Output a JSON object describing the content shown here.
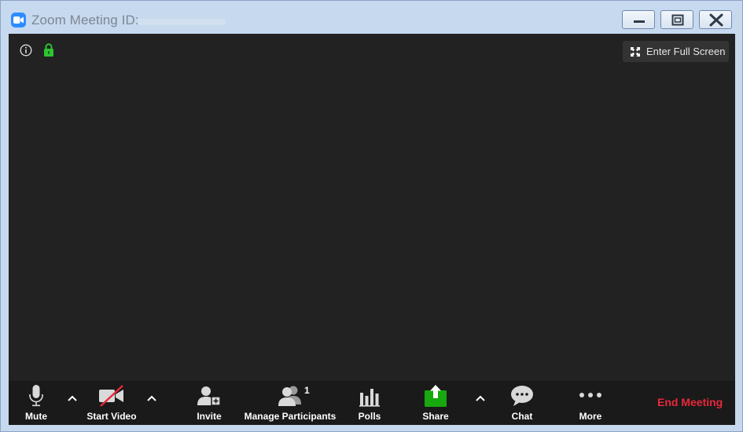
{
  "window": {
    "title": "Zoom Meeting ID:",
    "icons": {
      "app": "zoom-camera-icon",
      "minimize": "minimize-icon",
      "maximize": "maximize-icon",
      "close": "close-icon"
    }
  },
  "overlay": {
    "info_icon": "info-icon",
    "lock_icon": "encryption-lock-icon",
    "fullscreen_label": "Enter Full Screen"
  },
  "toolbar": {
    "mute": "Mute",
    "start_video": "Start Video",
    "invite": "Invite",
    "manage_participants": "Manage Participants",
    "participant_count": "1",
    "polls": "Polls",
    "share": "Share",
    "chat": "Chat",
    "more": "More",
    "end_meeting": "End Meeting"
  },
  "colors": {
    "accent": "#2d8cff",
    "share_green": "#18a80f",
    "end_red": "#e8283a",
    "video_area": "#222222",
    "toolbar_bg": "#1a1a1a"
  }
}
